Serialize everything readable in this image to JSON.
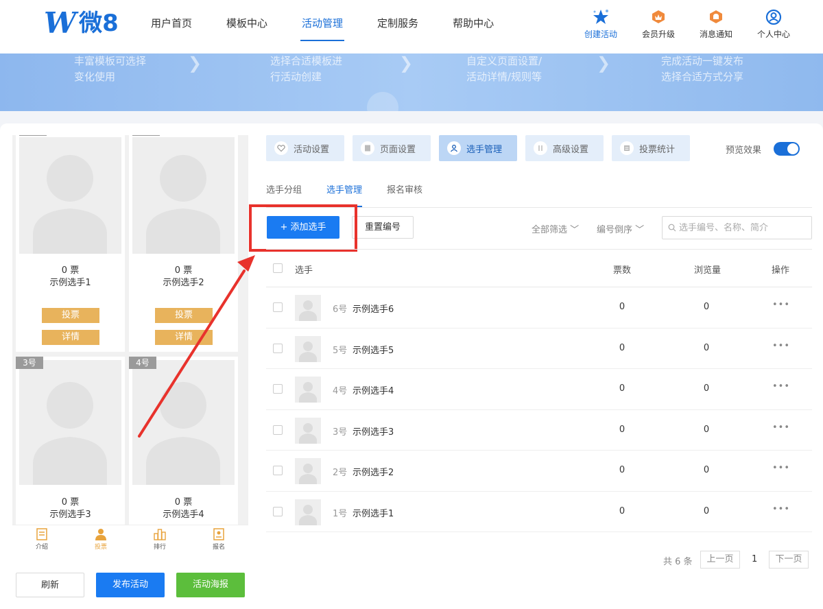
{
  "brand": {
    "logo_mark": "W",
    "logo_text": "微8"
  },
  "nav": {
    "items": [
      "用户首页",
      "模板中心",
      "活动管理",
      "定制服务",
      "帮助中心"
    ],
    "active": "活动管理"
  },
  "right_nav": [
    {
      "label": "创建活动",
      "icon": "star-icon"
    },
    {
      "label": "会员升级",
      "icon": "crown-icon"
    },
    {
      "label": "消息通知",
      "icon": "bell-icon"
    },
    {
      "label": "个人中心",
      "icon": "user-circle-icon"
    }
  ],
  "banner": {
    "steps": [
      {
        "line1": "丰富模板可选择",
        "line2": "变化使用"
      },
      {
        "line1": "选择合适模板进",
        "line2": "行活动创建"
      },
      {
        "line1": "自定义页面设置/",
        "line2": "活动详情/规则等"
      },
      {
        "line1": "完成活动一键发布",
        "line2": "选择合适方式分享"
      }
    ]
  },
  "preview": {
    "cards": [
      {
        "tag": "",
        "votes": "0 票",
        "name": "示例选手1",
        "vote_btn": "投票",
        "detail_btn": "详情"
      },
      {
        "tag": "",
        "votes": "0 票",
        "name": "示例选手2",
        "vote_btn": "投票",
        "detail_btn": "详情"
      },
      {
        "tag": "3号",
        "votes": "0 票",
        "name": "示例选手3"
      },
      {
        "tag": "4号",
        "votes": "0 票",
        "name": "示例选手4"
      }
    ],
    "bottom_nav": [
      {
        "label": "介绍",
        "icon": "document-icon"
      },
      {
        "label": "投票",
        "icon": "person-icon"
      },
      {
        "label": "排行",
        "icon": "bar-chart-icon"
      },
      {
        "label": "报名",
        "icon": "signup-icon"
      }
    ]
  },
  "left_buttons": {
    "refresh": "刷新",
    "publish": "发布活动",
    "poster": "活动海报"
  },
  "tabs": [
    "活动设置",
    "页面设置",
    "选手管理",
    "高级设置",
    "投票统计"
  ],
  "active_tab": "选手管理",
  "preview_toggle": {
    "label": "预览效果",
    "on": true
  },
  "subtabs": [
    "选手分组",
    "选手管理",
    "报名审核"
  ],
  "active_subtab": "选手管理",
  "toolbar": {
    "add": "+ 添加选手",
    "reset": "重置编号",
    "filter": "全部筛选 ﹀",
    "sort": "编号倒序 ﹀",
    "search_placeholder": "选手编号、名称、简介"
  },
  "table": {
    "headers": {
      "player": "选手",
      "votes": "票数",
      "views": "浏览量",
      "ops": "操作"
    },
    "rows": [
      {
        "num": "6号",
        "name": "示例选手6",
        "votes": "0",
        "views": "0"
      },
      {
        "num": "5号",
        "name": "示例选手5",
        "votes": "0",
        "views": "0"
      },
      {
        "num": "4号",
        "name": "示例选手4",
        "votes": "0",
        "views": "0"
      },
      {
        "num": "3号",
        "name": "示例选手3",
        "votes": "0",
        "views": "0"
      },
      {
        "num": "2号",
        "name": "示例选手2",
        "votes": "0",
        "views": "0"
      },
      {
        "num": "1号",
        "name": "示例选手1",
        "votes": "0",
        "views": "0"
      }
    ],
    "more_label": "•••"
  },
  "pagination": {
    "total": "共 6 条",
    "prev": "上一页",
    "page": "1",
    "next": "下一页"
  },
  "colors": {
    "primary": "#1a7bf2",
    "accent_orange": "#e8b35c",
    "green": "#5cbe3c",
    "annotation_red": "#e8322c"
  }
}
